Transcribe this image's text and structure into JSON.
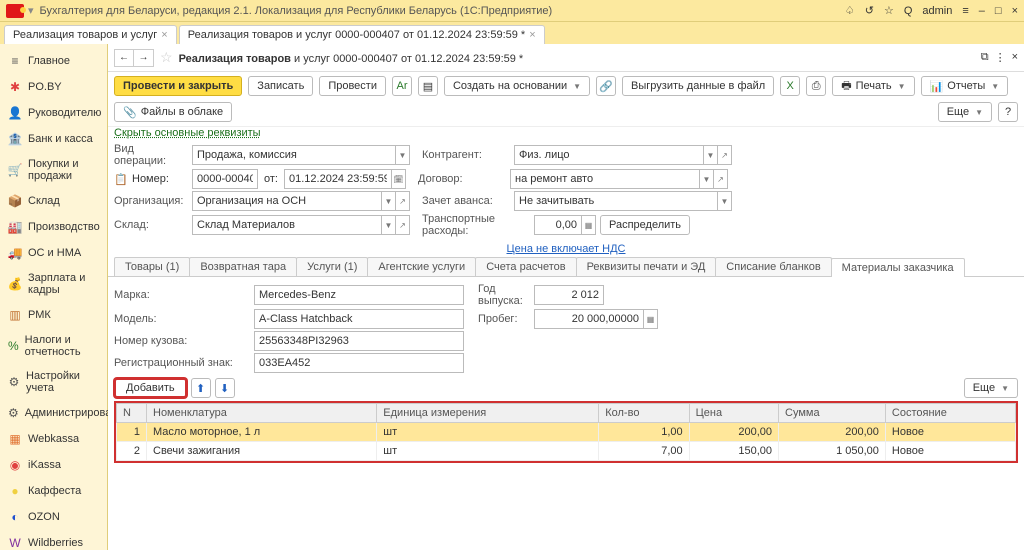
{
  "titlebar": {
    "title": "Бухгалтерия для Беларуси, редакция 2.1. Локализация для Республики Беларусь   (1С:Предприятие)",
    "user": "admin"
  },
  "apptabs": [
    {
      "label": "Реализация товаров и услуг"
    },
    {
      "label": "Реализация товаров и услуг 0000-000407 от 01.12.2024 23:59:59 *"
    }
  ],
  "sidebar": [
    {
      "icon": "≡",
      "label": "Главное",
      "color": "#555"
    },
    {
      "icon": "✱",
      "label": "PO.BY",
      "color": "#e04040"
    },
    {
      "icon": "👤",
      "label": "Руководителю",
      "color": "#555"
    },
    {
      "icon": "🏦",
      "label": "Банк и касса",
      "color": "#c07030"
    },
    {
      "icon": "🛒",
      "label": "Покупки и продажи",
      "color": "#555"
    },
    {
      "icon": "📦",
      "label": "Склад",
      "color": "#555"
    },
    {
      "icon": "🏭",
      "label": "Производство",
      "color": "#555"
    },
    {
      "icon": "🚚",
      "label": "ОС и НМА",
      "color": "#555"
    },
    {
      "icon": "💰",
      "label": "Зарплата и кадры",
      "color": "#555"
    },
    {
      "icon": "▥",
      "label": "РМК",
      "color": "#c07030"
    },
    {
      "icon": "%",
      "label": "Налоги и отчетность",
      "color": "#2a7a2a"
    },
    {
      "icon": "⚙",
      "label": "Настройки учета",
      "color": "#555"
    },
    {
      "icon": "⚙",
      "label": "Администрирование",
      "color": "#555"
    },
    {
      "icon": "▦",
      "label": "Webkassa",
      "color": "#e07030"
    },
    {
      "icon": "◉",
      "label": "iKassa",
      "color": "#e04040"
    },
    {
      "icon": "●",
      "label": "Каффеста",
      "color": "#f0d040"
    },
    {
      "icon": "◐",
      "label": "OZON",
      "color": "#2050d0"
    },
    {
      "icon": "W",
      "label": "Wildberries",
      "color": "#8030a0"
    }
  ],
  "doc": {
    "title_prefix": "Реализация товаров",
    "title_suffix": " и услуг 0000-000407 от 01.12.2024 23:59:59 *"
  },
  "toolbar": {
    "post_close": "Провести и закрыть",
    "write": "Записать",
    "post": "Провести",
    "create_based": "Создать на основании",
    "export": "Выгрузить данные в файл",
    "print": "Печать",
    "reports": "Отчеты",
    "cloud": "Файлы в облаке",
    "more": "Еще"
  },
  "link_hide": "Скрыть основные реквизиты",
  "fields": {
    "op_type_lbl": "Вид операции:",
    "op_type": "Продажа, комиссия",
    "counterparty_lbl": "Контрагент:",
    "counterparty": "Физ. лицо",
    "number_lbl": "Номер:",
    "number": "0000-000407",
    "from": "от:",
    "date": "01.12.2024 23:59:59",
    "contract_lbl": "Договор:",
    "contract": "на ремонт авто",
    "org_lbl": "Организация:",
    "org": "Организация на ОСН",
    "advance_lbl": "Зачет аванса:",
    "advance": "Не зачитывать",
    "warehouse_lbl": "Склад:",
    "warehouse": "Склад Материалов",
    "transport_lbl": "Транспортные расходы:",
    "transport": "0,00",
    "distribute": "Распределить"
  },
  "vat_link": "Цена не включает НДС",
  "tabs": [
    "Товары (1)",
    "Возвратная тара",
    "Услуги (1)",
    "Агентские услуги",
    "Счета расчетов",
    "Реквизиты печати и ЭД",
    "Списание бланков",
    "Материалы заказчика"
  ],
  "active_tab": 7,
  "car": {
    "brand_lbl": "Марка:",
    "brand": "Mercedes-Benz",
    "year_lbl": "Год выпуска:",
    "year": "2 012",
    "model_lbl": "Модель:",
    "model": "A-Class Hatchback",
    "mileage_lbl": "Пробег:",
    "mileage": "20 000,00000",
    "body_lbl": "Номер кузова:",
    "body": "25563348PI32963",
    "plate_lbl": "Регистрационный знак:",
    "plate": "033EA452"
  },
  "grid": {
    "add": "Добавить",
    "more": "Еще",
    "cols": [
      "N",
      "Номенклатура",
      "Единица измерения",
      "Кол-во",
      "Цена",
      "Сумма",
      "Состояние"
    ],
    "rows": [
      {
        "n": "1",
        "name": "Масло моторное, 1 л",
        "unit": "шт",
        "qty": "1,00",
        "price": "200,00",
        "sum": "200,00",
        "state": "Новое"
      },
      {
        "n": "2",
        "name": "Свечи зажигания",
        "unit": "шт",
        "qty": "7,00",
        "price": "150,00",
        "sum": "1 050,00",
        "state": "Новое"
      }
    ]
  }
}
